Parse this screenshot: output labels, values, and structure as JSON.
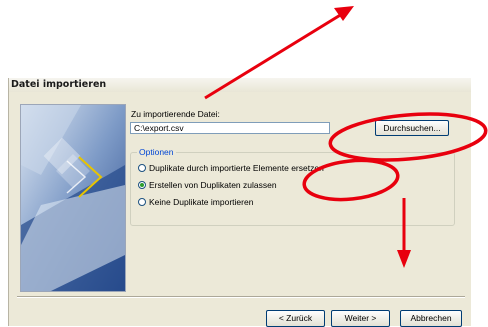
{
  "dialog": {
    "title": "Datei importieren",
    "file_label": "Zu importierende Datei:",
    "file_value": "C:\\export.csv",
    "browse_label": "Durchsuchen...",
    "options_legend": "Optionen",
    "options": [
      {
        "label": "Duplikate durch importierte Elemente ersetzen",
        "selected": false
      },
      {
        "label": "Erstellen von Duplikaten zulassen",
        "selected": true
      },
      {
        "label": "Keine Duplikate importieren",
        "selected": false
      }
    ],
    "buttons": {
      "back": "< Zurück",
      "next": "Weiter >",
      "cancel": "Abbrechen"
    }
  },
  "annotation_color": "#e8000e"
}
